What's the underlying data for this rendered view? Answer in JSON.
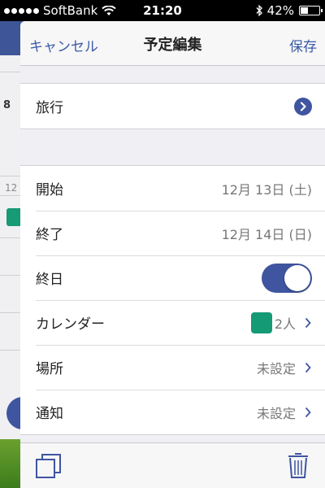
{
  "status_bar": {
    "carrier": "SoftBank",
    "time": "21:20",
    "battery": "42%",
    "battery_level": 0.42,
    "signal_bars": 5
  },
  "nav": {
    "cancel_label": "キャンセル",
    "title": "予定編集",
    "save_label": "保存"
  },
  "background": {
    "date_8": "8",
    "date_12": "12"
  },
  "event": {
    "title": "旅行"
  },
  "fields": {
    "start": {
      "label": "開始",
      "value": "12月 13日 (土)"
    },
    "end": {
      "label": "終了",
      "value": "12月 14日 (日)"
    },
    "all_day": {
      "label": "終日",
      "on": true
    },
    "calendar": {
      "label": "カレンダー",
      "value": "2人",
      "color": "#149a74"
    },
    "location": {
      "label": "場所",
      "value": "未設定"
    },
    "notification": {
      "label": "通知",
      "value": "未設定"
    }
  },
  "colors": {
    "accent": "#3f55a0",
    "link": "#3b5ba5"
  },
  "icons": {
    "copy": "copy-icon",
    "trash": "trash-icon"
  }
}
